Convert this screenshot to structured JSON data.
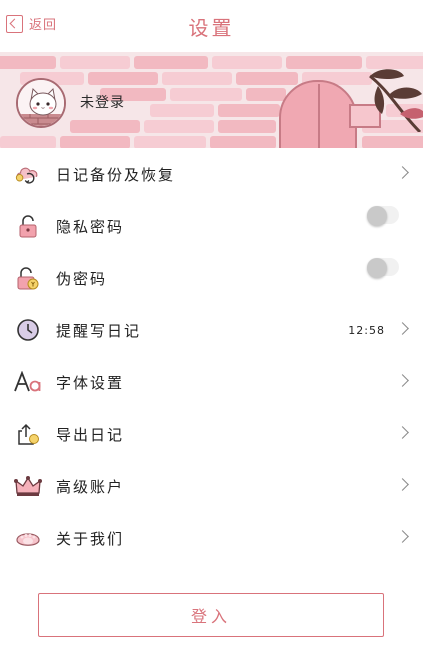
{
  "header": {
    "back_label": "返回",
    "title": "设置"
  },
  "profile": {
    "name": "未登录"
  },
  "settings": {
    "items": [
      {
        "key": "backup",
        "label": "日记备份及恢复",
        "icon": "cloud-sync-icon",
        "control": "chevron"
      },
      {
        "key": "privacy",
        "label": "隐私密码",
        "icon": "lock-icon",
        "control": "toggle",
        "enabled": false
      },
      {
        "key": "fake",
        "label": "伪密码",
        "icon": "lock-coin-icon",
        "control": "toggle",
        "enabled": false
      },
      {
        "key": "reminder",
        "label": "提醒写日记",
        "icon": "clock-icon",
        "control": "chevron",
        "value": "12:58"
      },
      {
        "key": "font",
        "label": "字体设置",
        "icon": "font-icon",
        "control": "chevron"
      },
      {
        "key": "export",
        "label": "导出日记",
        "icon": "export-icon",
        "control": "chevron"
      },
      {
        "key": "premium",
        "label": "高级账户",
        "icon": "crown-icon",
        "control": "chevron"
      },
      {
        "key": "about",
        "label": "关于我们",
        "icon": "paw-icon",
        "control": "chevron"
      }
    ]
  },
  "login": {
    "label": "登入"
  },
  "colors": {
    "accent": "#d9737b",
    "banner_bg": "#f6e6e8",
    "brick": "#f2b9c1"
  }
}
